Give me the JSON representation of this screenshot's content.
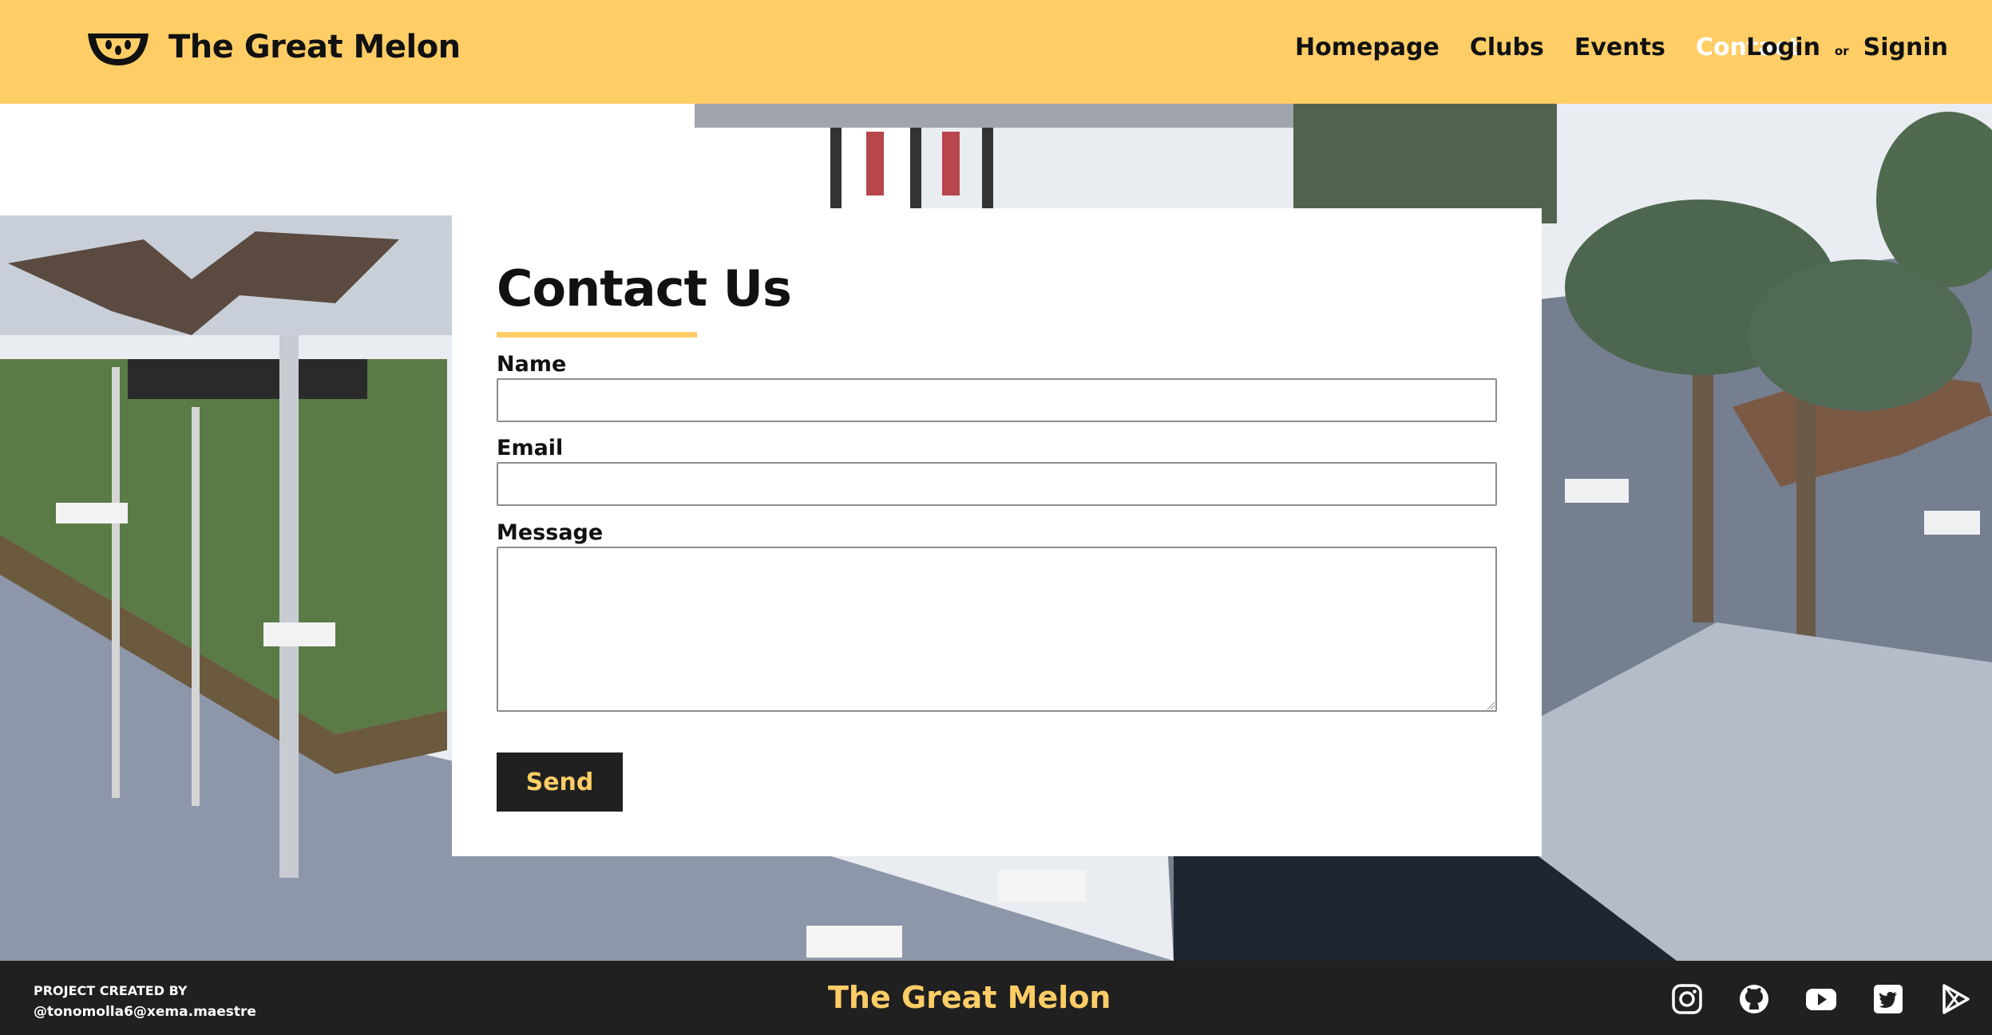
{
  "header": {
    "brand": "The Great Melon",
    "logo_icon": "melon-slice-icon",
    "nav": [
      {
        "label": "Homepage",
        "active": false
      },
      {
        "label": "Clubs",
        "active": false
      },
      {
        "label": "Events",
        "active": false
      },
      {
        "label": "Contact",
        "active": true
      }
    ],
    "login_label": "Login",
    "or_label": "or",
    "signin_label": "Signin"
  },
  "form": {
    "title": "Contact Us",
    "name_label": "Name",
    "name_value": "",
    "email_label": "Email",
    "email_value": "",
    "message_label": "Message",
    "message_value": "",
    "send_label": "Send"
  },
  "footer": {
    "credit_line1": "PROJECT CREATED BY",
    "credit_line2": "@tonomolla6@xema.maestre",
    "brand": "The Great Melon",
    "social_icons": [
      "instagram-icon",
      "github-icon",
      "youtube-icon",
      "twitter-icon",
      "google-play-icon"
    ]
  },
  "colors": {
    "accent": "#ffcd66",
    "dark": "#202020",
    "active_nav": "#ffffff",
    "card": "#ffffff"
  }
}
